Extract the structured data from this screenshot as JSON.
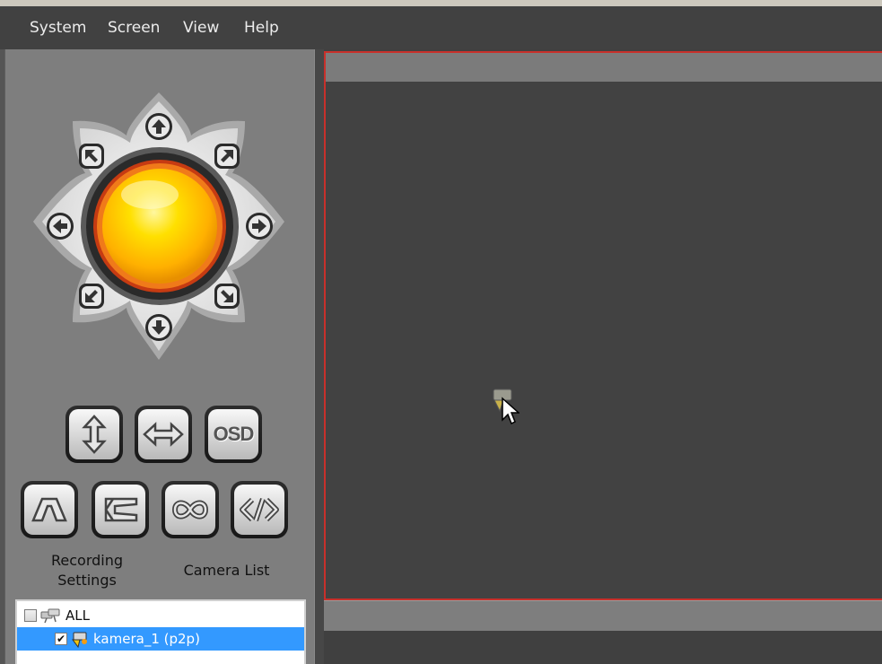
{
  "menu": {
    "system": "System",
    "screen": "Screen",
    "view": "View",
    "help": "Help"
  },
  "controls": {
    "osd_label": "OSD",
    "recording_settings": "Recording Settings",
    "camera_list": "Camera List"
  },
  "camera_tree": {
    "all_label": "ALL",
    "camera_label": "kamera_1 (p2p)",
    "camera_checked": "✔"
  },
  "colors": {
    "selection": "#3399ff",
    "view_border": "#c8302b",
    "ptz_center": "#ffd800"
  }
}
